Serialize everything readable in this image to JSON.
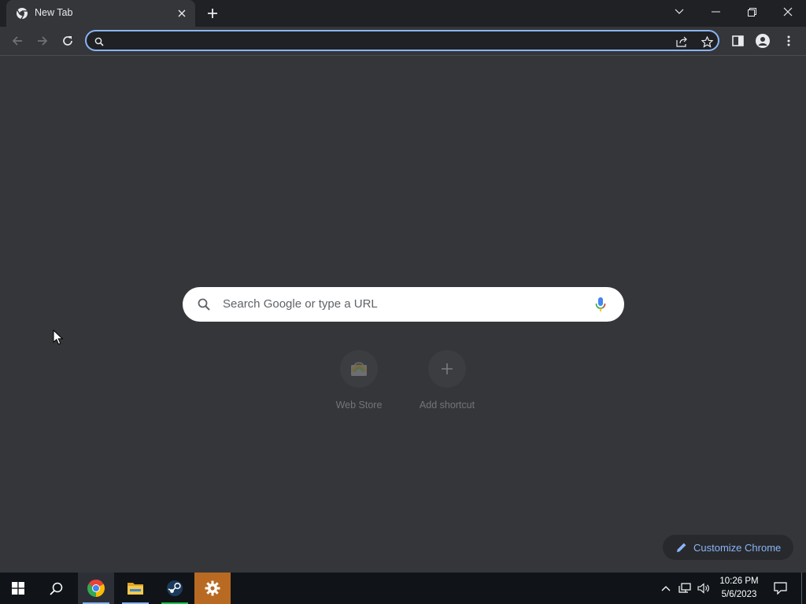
{
  "window": {
    "title": "New Tab"
  },
  "tab": {
    "title": "New Tab"
  },
  "omnibox": {
    "value": "",
    "placeholder": ""
  },
  "ntp": {
    "search_placeholder": "Search Google or type a URL",
    "shortcuts": [
      {
        "label": "Web Store",
        "icon": "web-store-icon"
      },
      {
        "label": "Add shortcut",
        "icon": "plus-icon"
      }
    ],
    "customize_label": "Customize Chrome"
  },
  "taskbar": {
    "apps": [
      {
        "name": "start",
        "icon": "windows-logo-icon"
      },
      {
        "name": "search",
        "icon": "search-icon"
      },
      {
        "name": "chrome",
        "icon": "chrome-icon"
      },
      {
        "name": "file-explorer",
        "icon": "folder-icon"
      },
      {
        "name": "steam",
        "icon": "steam-icon"
      },
      {
        "name": "settings",
        "icon": "gear-icon"
      }
    ],
    "time": "10:26 PM",
    "date": "5/6/2023"
  },
  "colors": {
    "accent": "#8ab4f8",
    "background": "#35363a",
    "tabstrip": "#202124",
    "taskbar": "#101418",
    "settings_orange": "#b96a22"
  }
}
